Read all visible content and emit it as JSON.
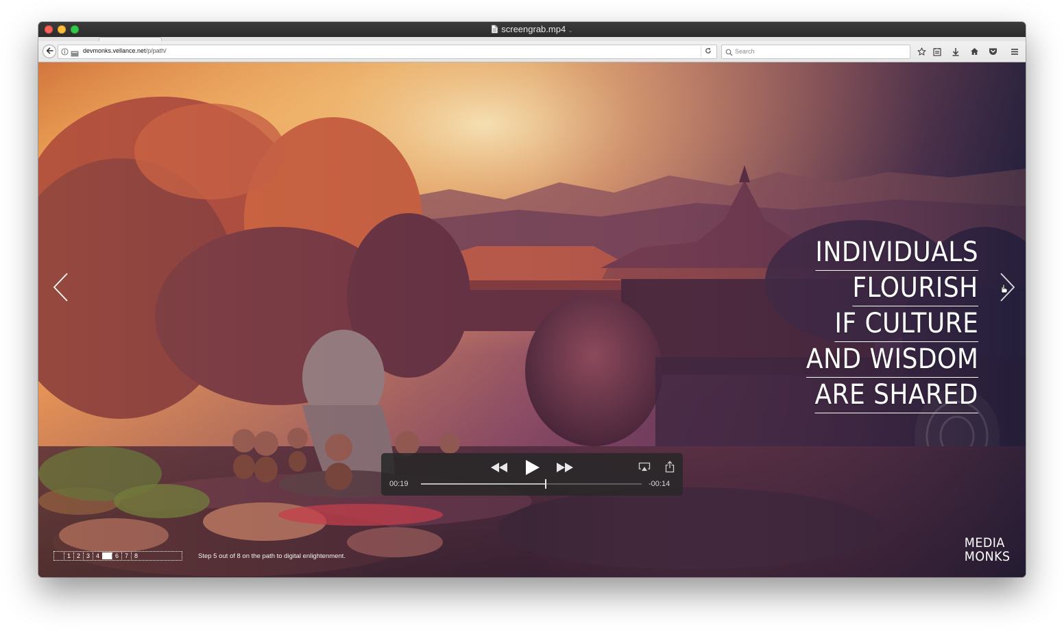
{
  "window": {
    "title": "screengrab.mp4",
    "title_icon": "document-icon"
  },
  "browser": {
    "url_host": "devmonks.vellance.net",
    "url_path": "/p/path/",
    "search_placeholder": "Search",
    "toolbar_icons": [
      "bookmark-star-icon",
      "reading-list-icon",
      "download-icon",
      "home-icon",
      "pocket-icon",
      "menu-icon"
    ]
  },
  "page": {
    "headline_lines": [
      "INDIVIDUALS",
      "FLOURISH",
      "IF CULTURE",
      "AND WISDOM",
      "ARE SHARED"
    ],
    "pager": {
      "items": [
        "1",
        "2",
        "3",
        "4",
        "5",
        "6",
        "7",
        "8"
      ],
      "active_index": 4
    },
    "step_text": "Step 5 out of 8 on the path to digital enlightenment.",
    "logo_line1": "MEDIA",
    "logo_line2": "MONKS"
  },
  "player": {
    "elapsed": "00:19",
    "remaining": "-00:14",
    "progress": 0.565
  },
  "colors": {
    "accent_text": "#ffffff",
    "player_bg": "#282828"
  }
}
